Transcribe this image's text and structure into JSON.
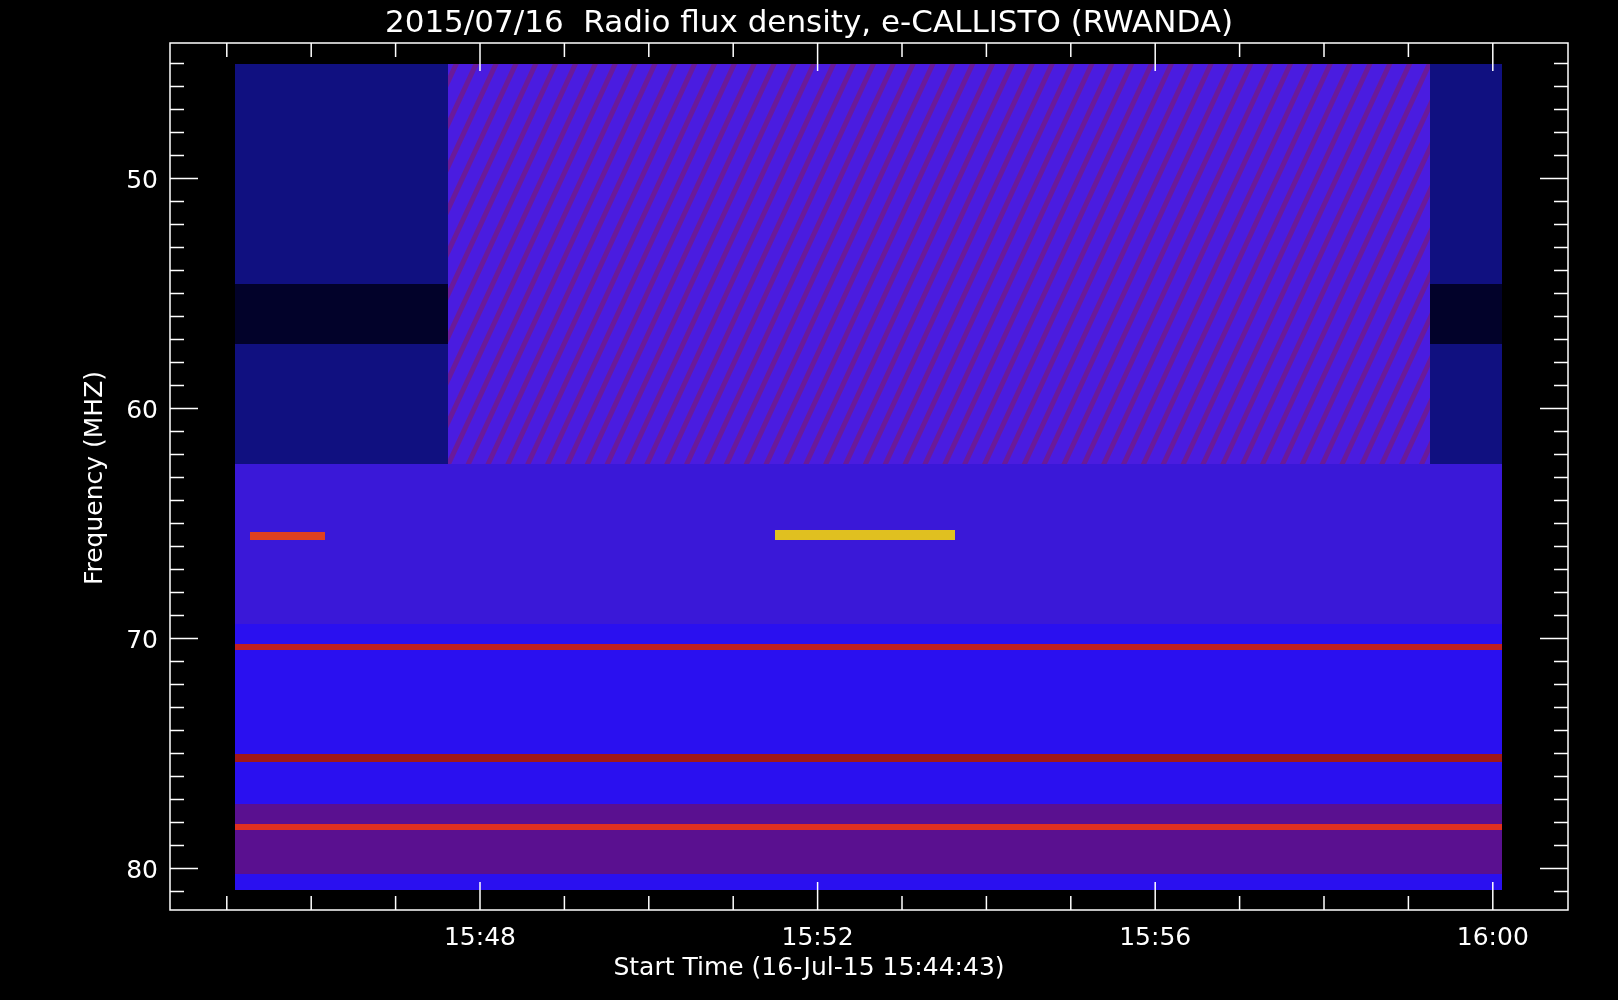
{
  "title": "2015/07/16  Radio flux density, e-CALLISTO (RWANDA)",
  "y_axis": {
    "label": "Frequency (MHZ)",
    "ticks": [
      "50",
      "60",
      "70",
      "80"
    ]
  },
  "x_axis": {
    "label": "Start Time (16-Jul-15 15:44:43)",
    "ticks": [
      "15:48",
      "15:52",
      "15:56",
      "16:00"
    ]
  }
}
